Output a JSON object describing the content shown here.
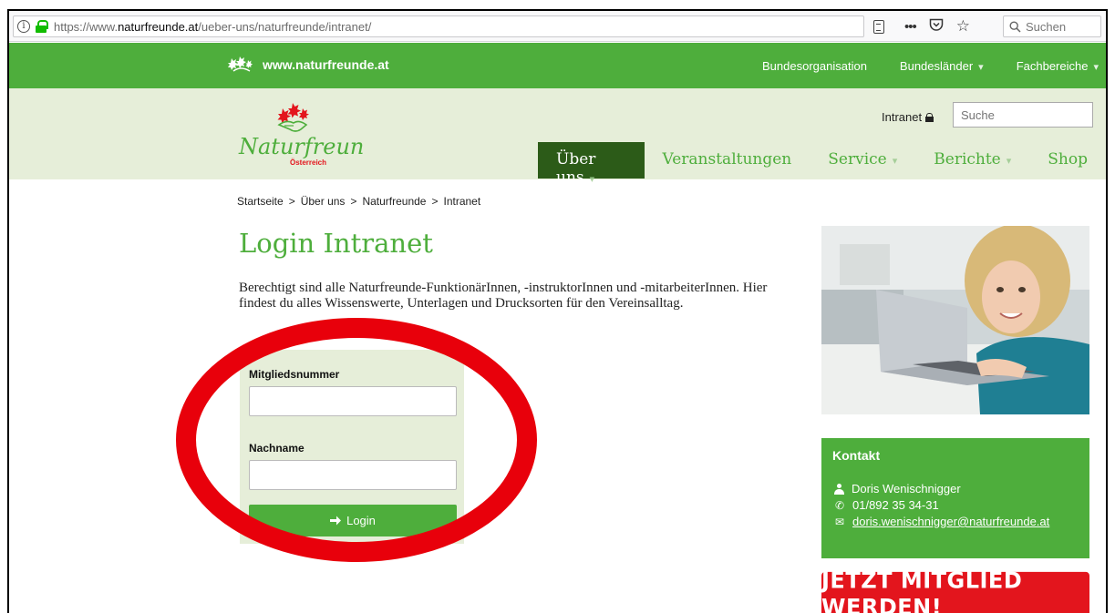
{
  "browser": {
    "url_prefix": "https://www.",
    "url_domain": "naturfreunde.at",
    "url_path": "/ueber-uns/naturfreunde/intranet/",
    "search_placeholder": "Suchen"
  },
  "topbar": {
    "site_name": "www.naturfreunde.at",
    "nav": [
      "Bundesorganisation",
      "Bundesländer",
      "Fachbereiche"
    ]
  },
  "header": {
    "logo_text": "Naturfreunde",
    "logo_subtext": "Österreich",
    "intranet_link": "Intranet",
    "search_placeholder": "Suche",
    "main_nav": [
      "Über uns",
      "Veranstaltungen",
      "Service",
      "Berichte",
      "Shop"
    ]
  },
  "breadcrumb": [
    "Startseite",
    ">",
    "Über uns",
    ">",
    "Naturfreunde",
    ">",
    "Intranet"
  ],
  "main": {
    "title": "Login Intranet",
    "intro": "Berechtigt sind alle Naturfreunde-FunktionärInnen, -instruktorInnen und -mitarbeiterInnen. Hier findest du alles Wissenswerte, Unterlagen und Drucksorten für den Vereinsalltag."
  },
  "login": {
    "member_label": "Mitgliedsnummer",
    "member_value": "",
    "surname_label": "Nachname",
    "surname_value": "",
    "button_label": "Login"
  },
  "sidebar": {
    "contact_title": "Kontakt",
    "contact_name": "Doris Wenischnigger",
    "contact_phone": "01/892 35 34-31",
    "contact_email": "doris.wenischnigger@naturfreunde.at",
    "cta_label": "JETZT MITGLIED WERDEN!"
  },
  "colors": {
    "brand_green": "#4eae3c",
    "dark_green": "#2c5b18",
    "light_green": "#e6eed9",
    "cta_red": "#e3151d",
    "annotation_red": "#e8000b"
  },
  "icons": [
    "info-icon",
    "lock-icon",
    "reader-view-icon",
    "more-icon",
    "pocket-icon",
    "bookmark-star-icon",
    "search-icon",
    "naturfreunde-logo",
    "person-icon",
    "phone-icon",
    "mail-icon",
    "arrow-right-icon"
  ]
}
